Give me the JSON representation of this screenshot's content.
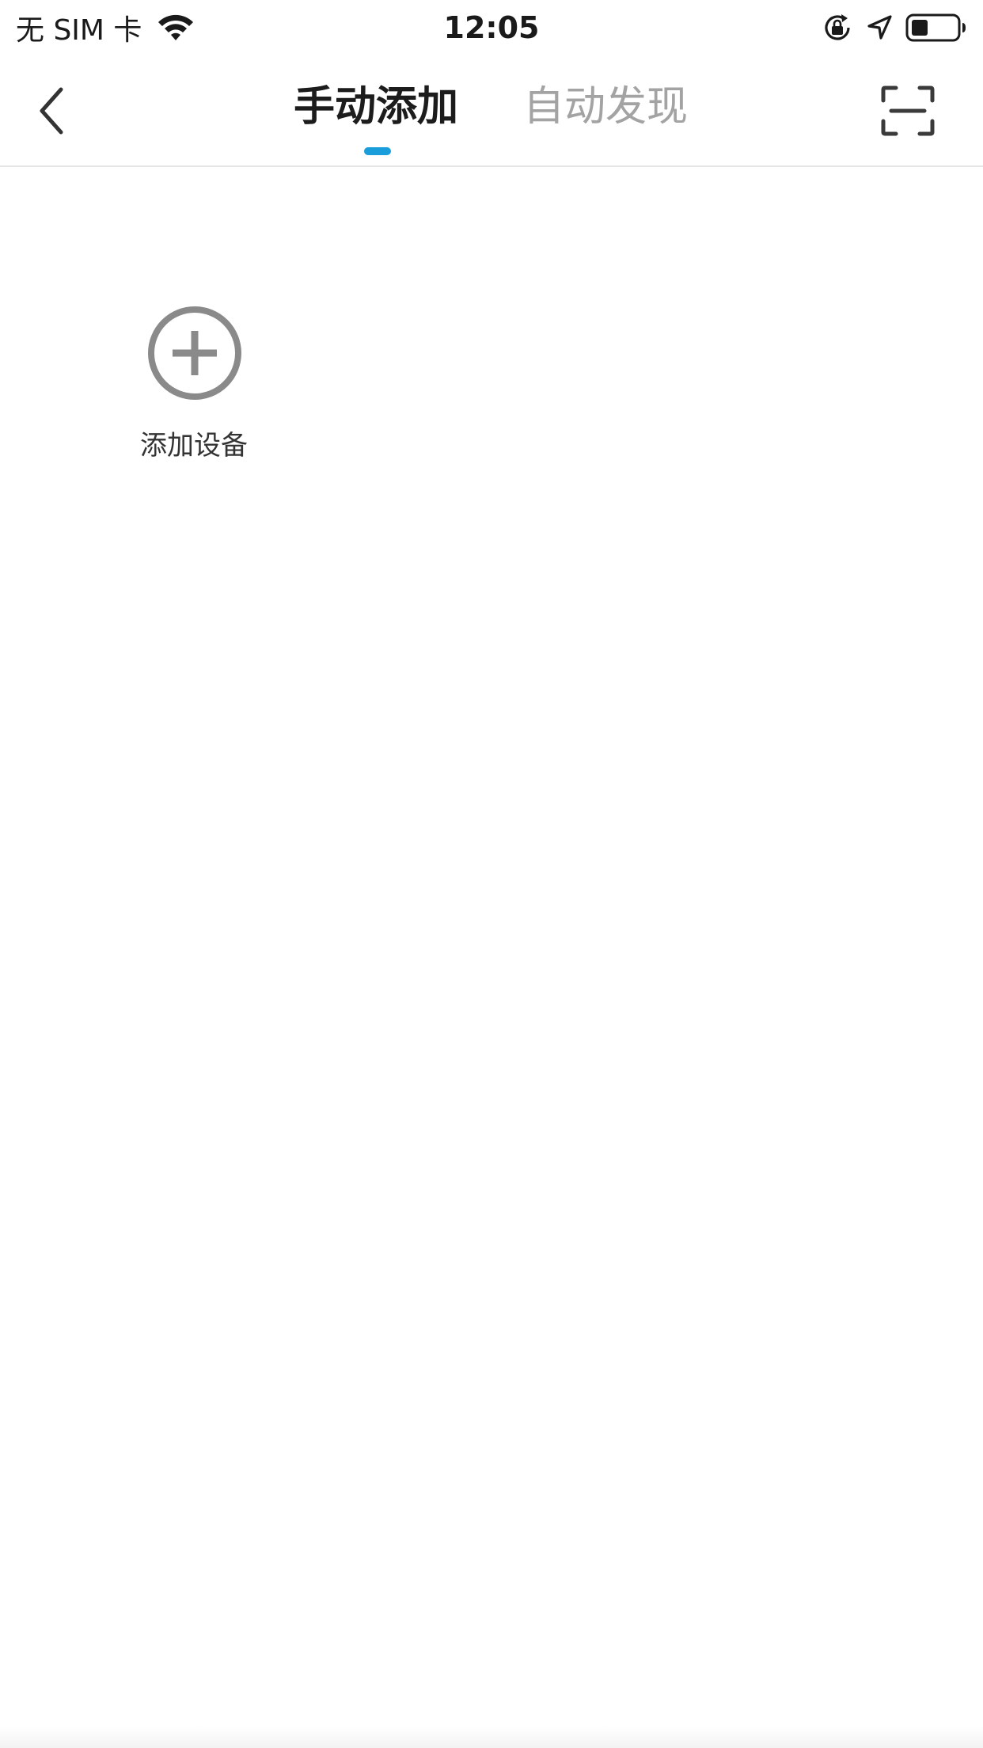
{
  "status_bar": {
    "carrier": "无 SIM 卡",
    "time": "12:05",
    "icons": [
      "wifi-icon",
      "rotation-lock-icon",
      "location-arrow-icon",
      "battery-icon"
    ]
  },
  "nav": {
    "back_icon": "chevron-left-icon",
    "tabs": [
      {
        "label": "手动添加",
        "active": true
      },
      {
        "label": "自动发现",
        "active": false
      }
    ],
    "scan_icon": "scan-icon",
    "accent_color": "#1a9ddb"
  },
  "main": {
    "add_device": {
      "icon": "add-circle-icon",
      "label": "添加设备"
    }
  }
}
